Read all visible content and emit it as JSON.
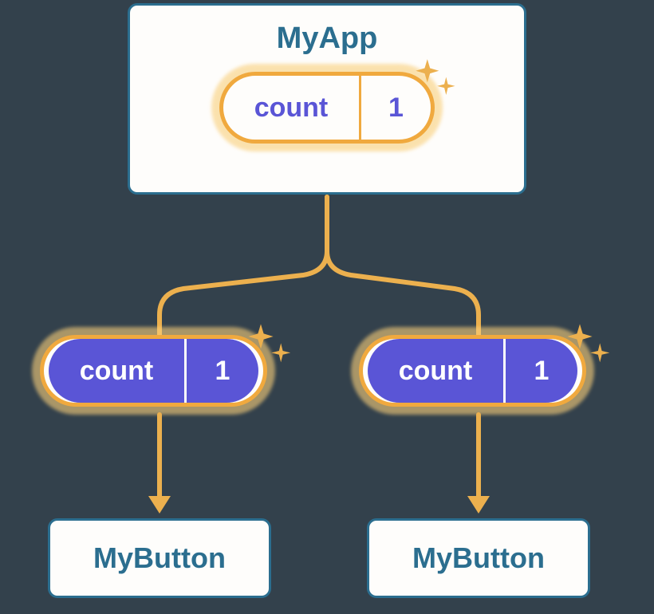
{
  "parent": {
    "title": "MyApp",
    "state": {
      "label": "count",
      "value": "1"
    }
  },
  "props": {
    "left": {
      "label": "count",
      "value": "1"
    },
    "right": {
      "label": "count",
      "value": "1"
    }
  },
  "children": {
    "left": {
      "title": "MyButton"
    },
    "right": {
      "title": "MyButton"
    }
  },
  "colors": {
    "boxBorder": "#2b6e8f",
    "boxBg": "#fefdfb",
    "accent": "#f0a93e",
    "glow": "#f9cf7a",
    "pillFill": "#5a55d6",
    "bg": "#33414c"
  }
}
